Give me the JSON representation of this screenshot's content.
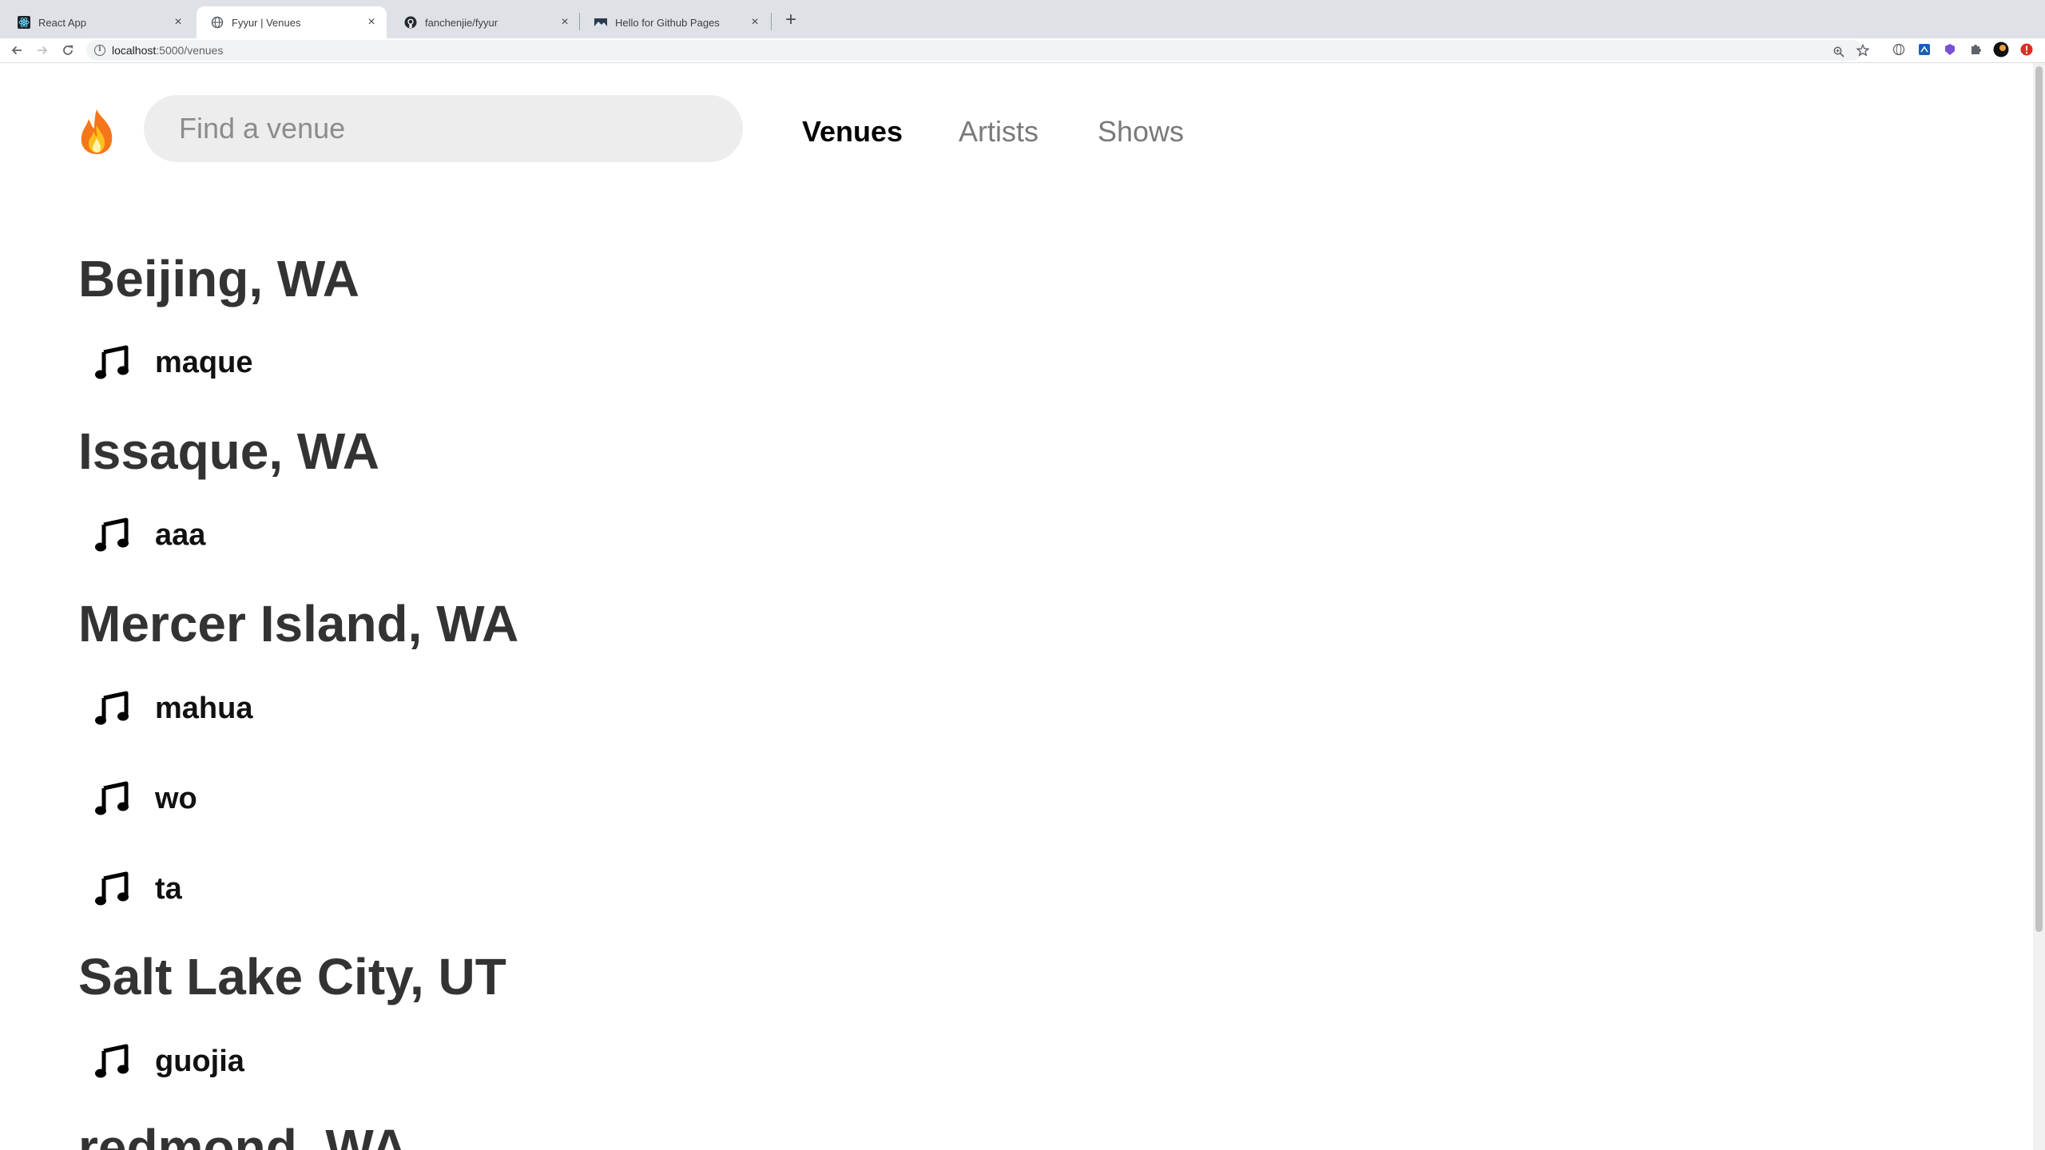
{
  "browser": {
    "tabs": [
      {
        "title": "React App",
        "icon": "react-favicon",
        "active": false
      },
      {
        "title": "Fyyur | Venues",
        "icon": "globe-favicon",
        "active": true
      },
      {
        "title": "fanchenjie/fyyur",
        "icon": "github-favicon",
        "active": false
      },
      {
        "title": "Hello for Github Pages",
        "icon": "landscape-favicon",
        "active": false
      }
    ],
    "new_tab_label": "+",
    "url_host": "localhost",
    "url_path": ":5000/venues"
  },
  "page": {
    "logo": "🔥",
    "search": {
      "placeholder": "Find a venue",
      "value": ""
    },
    "nav": {
      "venues": "Venues",
      "artists": "Artists",
      "shows": "Shows",
      "active": "Venues"
    },
    "groups": [
      {
        "city": "Beijing, WA",
        "venues": [
          "maque"
        ]
      },
      {
        "city": "Issaque, WA",
        "venues": [
          "aaa"
        ]
      },
      {
        "city": "Mercer Island, WA",
        "venues": [
          "mahua",
          "wo",
          "ta"
        ]
      },
      {
        "city": "Salt Lake City, UT",
        "venues": [
          "guojia"
        ]
      },
      {
        "city": "redmond, WA",
        "venues": []
      }
    ],
    "venue_icon": "music-note-icon"
  },
  "colors": {
    "tabstrip": "#dee1e6",
    "heading": "#333333",
    "nav_active": "#000000",
    "nav_inactive": "#7a7a7a",
    "search_bg": "#ededed"
  }
}
